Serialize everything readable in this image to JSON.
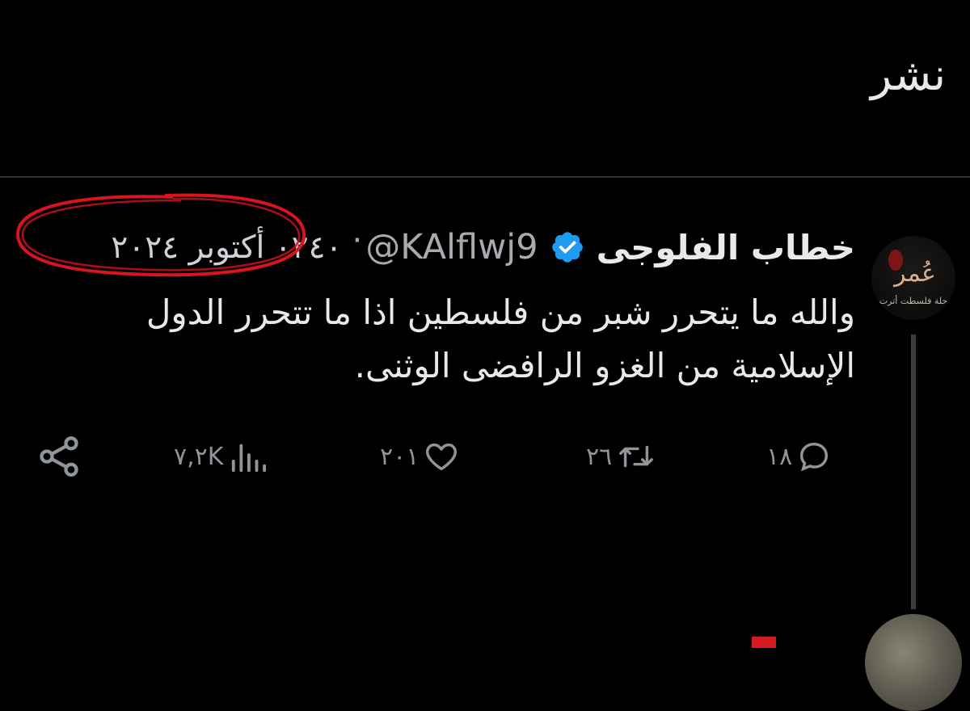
{
  "header": {
    "title": "نشر"
  },
  "tweet": {
    "display_name": "خطاب الفلوجى",
    "handle": "@KAlflwj9",
    "separator": "·",
    "time": "٠٢٤٠ أكتوبر ٢٠٢٤",
    "text": "والله ما يتحرر شبر من فلسطين اذا ما تتحرر الدول الإسلامية من الغزو الرافضى الوثنى.",
    "avatar_text": "عُمر",
    "avatar_subtext": "حلة فلسطت أترت"
  },
  "actions": {
    "replies": "١٨",
    "retweets": "٢٦",
    "likes": "٢٠١",
    "views": "٧,٢K"
  },
  "colors": {
    "background": "#000000",
    "verified": "#1d9bf0",
    "annotation": "#d8141c",
    "muted": "#8f959b"
  },
  "icons": {
    "reply": "reply-icon",
    "retweet": "retweet-icon",
    "like": "heart-icon",
    "views": "views-icon",
    "share": "share-icon",
    "verified": "verified-badge-icon"
  }
}
